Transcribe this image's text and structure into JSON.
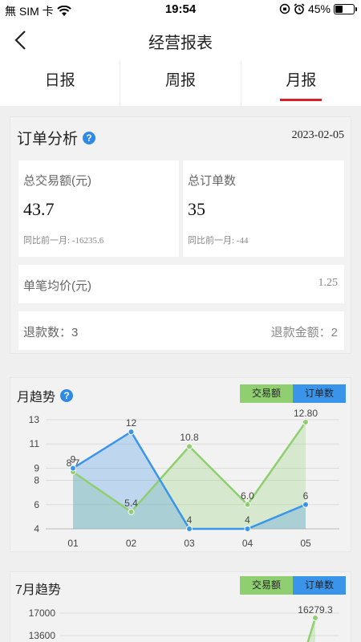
{
  "status": {
    "carrier": "無 SIM 卡",
    "time": "19:54",
    "battery": "45%",
    "battery_level": 0.45
  },
  "nav": {
    "title": "经营报表"
  },
  "tabs": [
    {
      "label": "日报"
    },
    {
      "label": "周报"
    },
    {
      "label": "月报"
    }
  ],
  "active_tab": 2,
  "order_analysis": {
    "title": "订单分析",
    "date": "2023-02-05",
    "total_amount": {
      "label": "总交易额(元)",
      "value": "43.7",
      "compare": "同比前一月: -16235.6"
    },
    "total_orders": {
      "label": "总订单数",
      "value": "35",
      "compare": "同比前一月: -44"
    },
    "avg_price": {
      "label": "单笔均价(元)",
      "value": "1.25"
    },
    "refund_count": "退款数：3",
    "refund_amount": "退款金额：2"
  },
  "legend": {
    "amount": "交易额",
    "orders": "订单数"
  },
  "colors": {
    "green": "#8fcf6f",
    "blue": "#3a95ea",
    "accent": "#d81e28"
  },
  "chart_data": [
    {
      "type": "area",
      "title": "月趋势",
      "categories": [
        "01",
        "02",
        "03",
        "04",
        "05"
      ],
      "y_ticks": [
        4,
        6,
        8,
        9,
        11,
        13
      ],
      "ylim": [
        4,
        13
      ],
      "series": [
        {
          "name": "交易额",
          "values": [
            8.7,
            5.4,
            10.8,
            6.0,
            12.8
          ],
          "labels": [
            "8.7",
            "5.4",
            "10.8",
            "6.0",
            "12.80"
          ]
        },
        {
          "name": "订单数",
          "values": [
            9,
            12,
            4,
            4,
            6
          ],
          "labels": [
            "9",
            "12",
            "4",
            "4",
            "6"
          ]
        }
      ],
      "legend_position": "top-right"
    },
    {
      "type": "area",
      "title": "7月趋势",
      "y_ticks": [
        13600,
        17000
      ],
      "series": [
        {
          "name": "交易额",
          "point_label": "16279.3",
          "point_value": 16279.3
        }
      ],
      "legend_position": "top-right"
    }
  ]
}
